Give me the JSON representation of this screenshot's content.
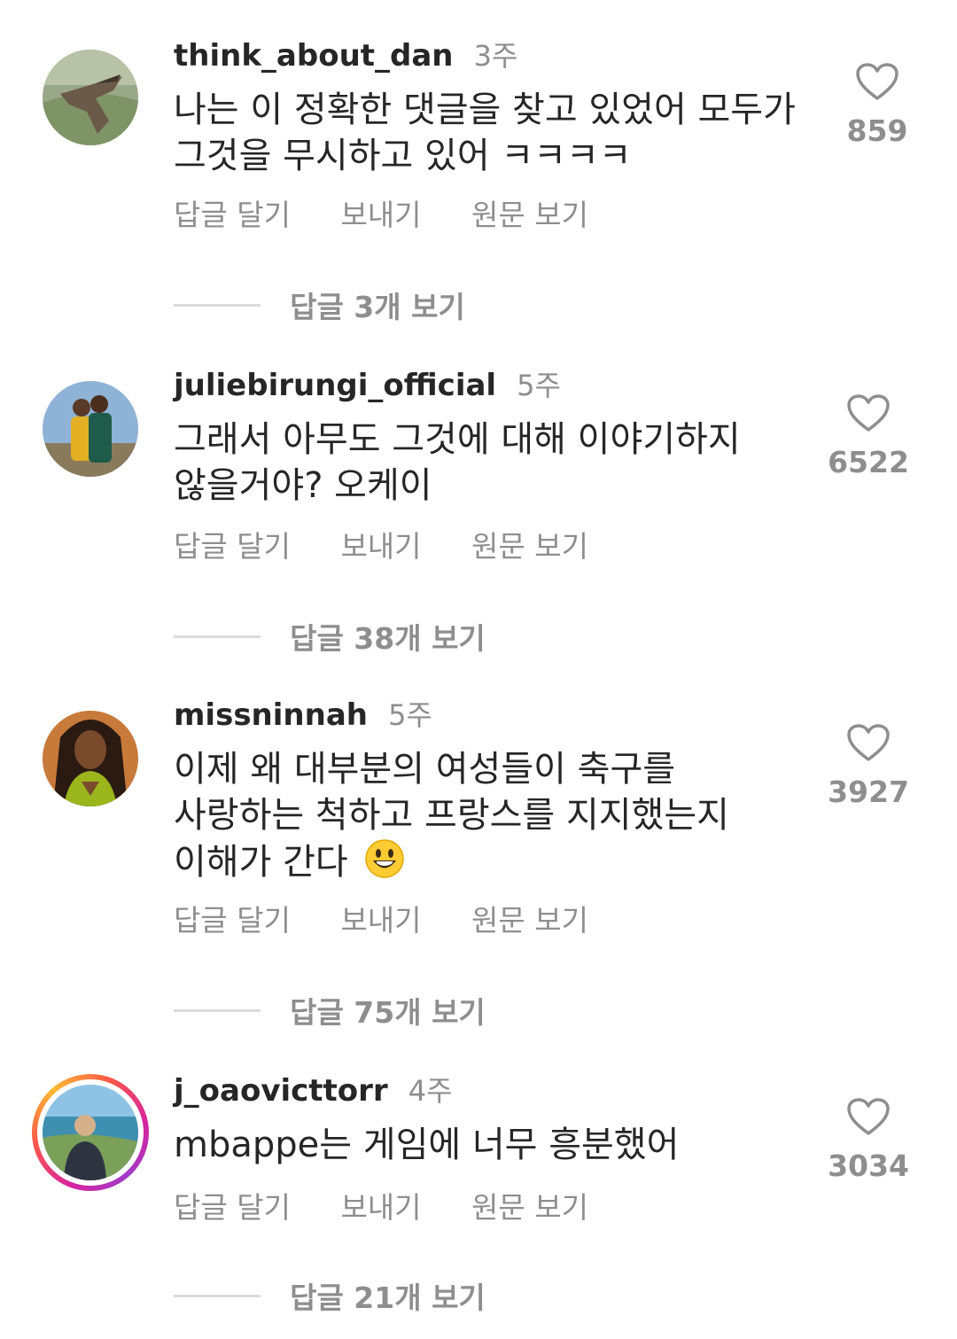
{
  "comments": [
    {
      "username": "think_about_dan",
      "time": "3주",
      "text": [
        "나는 이 정확한 댓글을 찾고 있었어 모두가",
        "그것을 무시하고 있어 ㅋㅋㅋㅋ"
      ],
      "likes": "859",
      "actions": [
        "답글 달기",
        "보내기",
        "원문 보기"
      ],
      "replies_label": "답글 3개 보기"
    },
    {
      "username": "juliebirungi_official",
      "time": "5주",
      "text": [
        "그래서 아무도 그것에 대해 이야기하지",
        "않을거야? 오케이"
      ],
      "likes": "6522",
      "actions": [
        "답글 달기",
        "보내기",
        "원문 보기"
      ],
      "replies_label": "답글 38개 보기"
    },
    {
      "username": "missninnah",
      "time": "5주",
      "text": [
        "이제 왜 대부분의 여성들이 축구를",
        "사랑하는 척하고 프랑스를 지지했는지",
        "이해가 간다"
      ],
      "emoji": "smiling-face-emoji",
      "likes": "3927",
      "actions": [
        "답글 달기",
        "보내기",
        "원문 보기"
      ],
      "replies_label": "답글 75개 보기"
    },
    {
      "username": "j_oaovicttorr",
      "time": "4주",
      "text": [
        "mbappe는 게임에 너무 흥분했어"
      ],
      "likes": "3034",
      "actions": [
        "답글 달기",
        "보내기",
        "원문 보기"
      ],
      "replies_label": "답글 21개 보기",
      "story_ring": true
    }
  ],
  "icons": {
    "like": "heart-outline-icon",
    "story_ring_colors": [
      "#d6249f",
      "#fd5949",
      "#fdb933"
    ]
  },
  "colors": {
    "primary_text": "#262626",
    "secondary_text": "#8e8e8e",
    "divider": "#dbdbdb"
  }
}
